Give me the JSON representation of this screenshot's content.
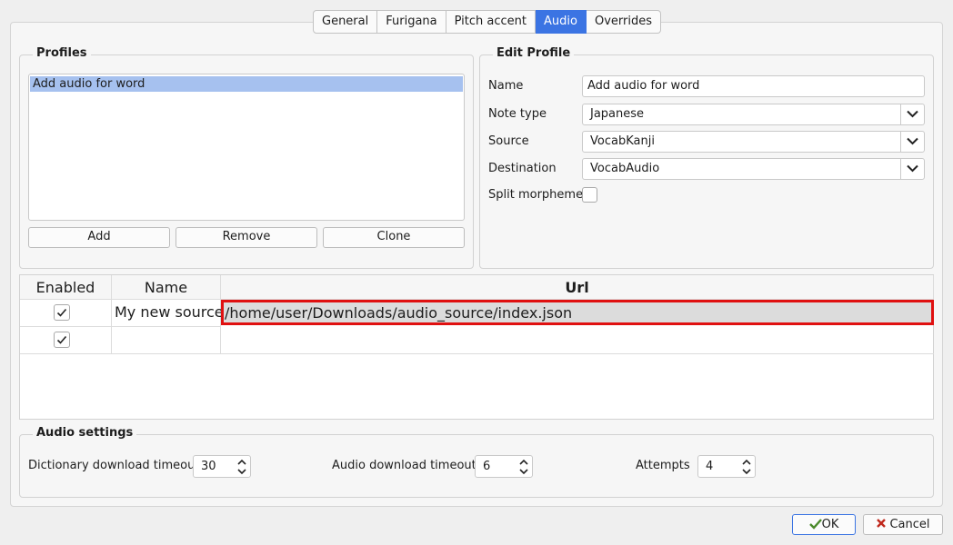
{
  "tabs": [
    {
      "label": "General",
      "active": false
    },
    {
      "label": "Furigana",
      "active": false
    },
    {
      "label": "Pitch accent",
      "active": false
    },
    {
      "label": "Audio",
      "active": true
    },
    {
      "label": "Overrides",
      "active": false
    }
  ],
  "profiles": {
    "title": "Profiles",
    "items": [
      "Add audio for word"
    ],
    "add_label": "Add",
    "remove_label": "Remove",
    "clone_label": "Clone"
  },
  "edit_profile": {
    "title": "Edit Profile",
    "name_label": "Name",
    "name_value": "Add audio for word",
    "note_type_label": "Note type",
    "note_type_value": "Japanese",
    "source_label": "Source",
    "source_value": "VocabKanji",
    "destination_label": "Destination",
    "destination_value": "VocabAudio",
    "split_label": "Split morphemes",
    "split_checked": false
  },
  "sources_table": {
    "headers": [
      "Enabled",
      "Name",
      "Url"
    ],
    "rows": [
      {
        "enabled": true,
        "name": "My new source",
        "url": "/home/user/Downloads/audio_source/index.json"
      },
      {
        "enabled": true,
        "name": "",
        "url": ""
      }
    ]
  },
  "audio_settings": {
    "title": "Audio settings",
    "dict_timeout_label": "Dictionary download timeout",
    "dict_timeout_value": "30",
    "audio_timeout_label": "Audio download timeout",
    "audio_timeout_value": "6",
    "attempts_label": "Attempts",
    "attempts_value": "4"
  },
  "dialog": {
    "ok_label": "OK",
    "cancel_label": "Cancel"
  },
  "colors": {
    "accent": "#3b74e3",
    "selection": "#a6c1ef",
    "error_outline": "#e01010"
  }
}
